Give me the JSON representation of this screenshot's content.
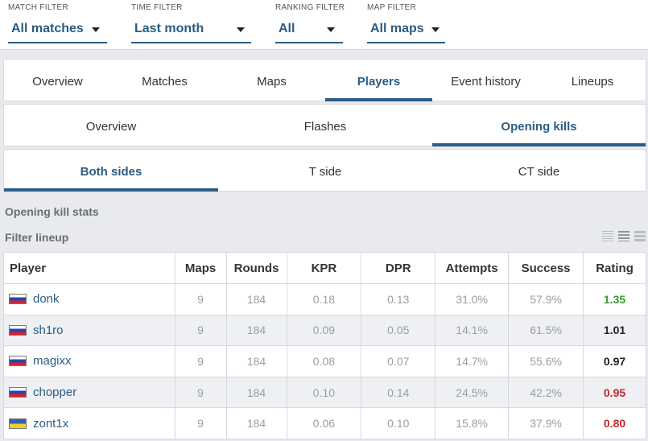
{
  "filters": [
    {
      "label": "MATCH FILTER",
      "value": "All matches"
    },
    {
      "label": "TIME FILTER",
      "value": "Last month"
    },
    {
      "label": "RANKING FILTER",
      "value": "All"
    },
    {
      "label": "MAP FILTER",
      "value": "All maps"
    }
  ],
  "main_tabs": [
    "Overview",
    "Matches",
    "Maps",
    "Players",
    "Event history",
    "Lineups"
  ],
  "main_tabs_active": "Players",
  "sub_tabs": [
    "Overview",
    "Flashes",
    "Opening kills"
  ],
  "sub_tabs_active": "Opening kills",
  "side_tabs": [
    "Both sides",
    "T side",
    "CT side"
  ],
  "side_tabs_active": "Both sides",
  "section_title": "Opening kill stats",
  "filter_lineup_label": "Filter lineup",
  "table": {
    "headers": [
      "Player",
      "Maps",
      "Rounds",
      "KPR",
      "DPR",
      "Attempts",
      "Success",
      "Rating"
    ],
    "rows": [
      {
        "flag": "ru",
        "player": "donk",
        "maps": "9",
        "rounds": "184",
        "kpr": "0.18",
        "dpr": "0.13",
        "attempts": "31.0%",
        "success": "57.9%",
        "rating": "1.35",
        "rating_color": "#3a9a2f"
      },
      {
        "flag": "ru",
        "player": "sh1ro",
        "maps": "9",
        "rounds": "184",
        "kpr": "0.09",
        "dpr": "0.05",
        "attempts": "14.1%",
        "success": "61.5%",
        "rating": "1.01",
        "rating_color": "#222222"
      },
      {
        "flag": "ru",
        "player": "magixx",
        "maps": "9",
        "rounds": "184",
        "kpr": "0.08",
        "dpr": "0.07",
        "attempts": "14.7%",
        "success": "55.6%",
        "rating": "0.97",
        "rating_color": "#222222"
      },
      {
        "flag": "ru",
        "player": "chopper",
        "maps": "9",
        "rounds": "184",
        "kpr": "0.10",
        "dpr": "0.14",
        "attempts": "24.5%",
        "success": "42.2%",
        "rating": "0.95",
        "rating_color": "#c0282d"
      },
      {
        "flag": "ua",
        "player": "zont1x",
        "maps": "9",
        "rounds": "184",
        "kpr": "0.06",
        "dpr": "0.10",
        "attempts": "15.8%",
        "success": "37.9%",
        "rating": "0.80",
        "rating_color": "#c0282d"
      }
    ]
  },
  "colors": {
    "accent": "#2a5d85",
    "background": "#e8eaee"
  }
}
